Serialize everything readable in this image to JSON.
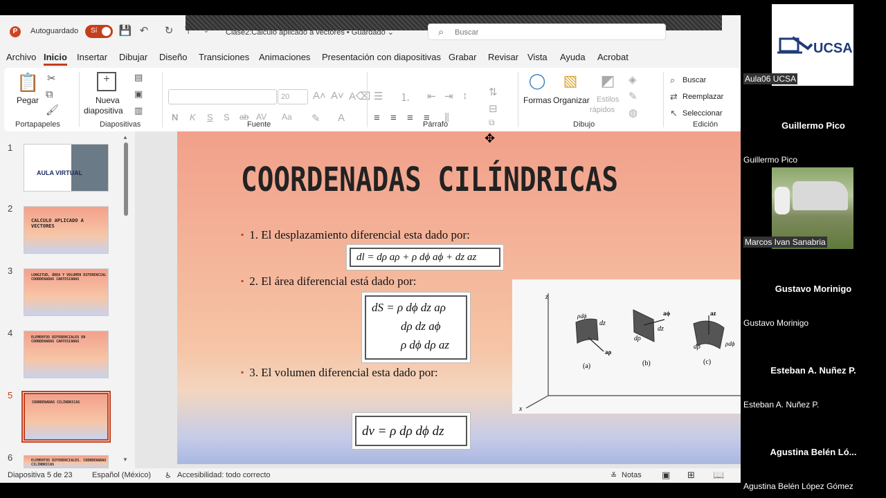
{
  "window": {
    "autosave_label": "Autoguardado",
    "autosave_state": "Sí",
    "filename": "Clase2:Cálculo aplicado a vectores • Guardado ⌄",
    "search_placeholder": "Buscar"
  },
  "menu_tabs": [
    "Archivo",
    "Inicio",
    "Insertar",
    "Dibujar",
    "Diseño",
    "Transiciones",
    "Animaciones",
    "Presentación con diapositivas",
    "Grabar",
    "Revisar",
    "Vista",
    "Ayuda",
    "Acrobat"
  ],
  "ribbon": {
    "groups": {
      "portapapeles": "Portapapeles",
      "diapositivas": "Diapositivas",
      "fuente": "Fuente",
      "parrafo": "Párrafo",
      "dibujo": "Dibujo",
      "edicion": "Edición"
    },
    "pegar": "Pegar",
    "nueva_1": "Nueva",
    "nueva_2": "diapositiva",
    "font_size": "20",
    "bold": "N",
    "italic": "K",
    "underline": "S",
    "strike": "S",
    "formas": "Formas",
    "organizar": "Organizar",
    "estilos_1": "Estilos",
    "estilos_2": "rápidos",
    "buscar": "Buscar",
    "reemplazar": "Reemplazar",
    "seleccionar": "Seleccionar"
  },
  "thumbnails": [
    {
      "num": "1",
      "title": "AULA VIRTUAL"
    },
    {
      "num": "2",
      "title": "CALCULO APLICADO A VECTORES"
    },
    {
      "num": "3",
      "title": "LONGITUD, ÁREA Y VOLUMEN DIFERENCIAL COORDENADAS CARTESIANAS"
    },
    {
      "num": "4",
      "title": "ELEMENTOS DIFERENCIALES EN COORDENADAS CARTESIANAS"
    },
    {
      "num": "5",
      "title": "COORDENADAS CILÍNDRICAS"
    },
    {
      "num": "6",
      "title": "ELEMENTOS DIFERENCIALES. COORDENADAS CILÍNDRICAS"
    }
  ],
  "slide": {
    "title": "COORDENADAS CILÍNDRICAS",
    "bullets": [
      "1. El desplazamiento diferencial esta dado por:",
      "2. El área diferencial está dado por:",
      "3. El volumen diferencial esta dado por:"
    ],
    "formula_dl": "dl = dρ aρ + ρ dϕ aϕ + dz az",
    "formula_ds_1": "dS = ρ dϕ dz aρ",
    "formula_ds_2": "dρ dz aϕ",
    "formula_ds_3": "ρ dϕ dρ az",
    "formula_dv": "dv = ρ dρ dϕ dz",
    "figure_labels": {
      "z": "z",
      "x": "x",
      "a": "(a)",
      "b": "(b)",
      "c": "(c)",
      "rho_dphi": "ρdϕ",
      "dz": "dz",
      "a_rho": "aρ",
      "a_phi": "aϕ",
      "d_rho": "dρ",
      "a_z": "az",
      "rho_dphi_c": "ρdϕ",
      "d_rho_c": "dρ"
    }
  },
  "status": {
    "slide_of": "Diapositiva 5 de 23",
    "language": "Español (México)",
    "accessibility": "Accesibilidad: todo correcto",
    "notes": "Notas"
  },
  "participants": [
    {
      "big": "",
      "small": "Aula06 UCSA",
      "logo": "UCSA",
      "has_video": true
    },
    {
      "big": "Guillermo Pico",
      "small": "Guillermo Pico",
      "has_video": false
    },
    {
      "big": "",
      "small": "Marcos Ivan Sanabria",
      "has_video": true
    },
    {
      "big": "Gustavo Morinigo",
      "small": "Gustavo Morinigo",
      "has_video": false
    },
    {
      "big": "Esteban A. Nuñez P.",
      "small": "Esteban A. Nuñez P.",
      "has_video": false
    },
    {
      "big": "Agustina Belén Ló...",
      "small": "Agustina Belén López Gómez",
      "has_video": false
    }
  ],
  "colors": {
    "accent": "#c43e1c",
    "slide_top": "#f2a08a",
    "slide_bottom": "#a9b7e1"
  }
}
